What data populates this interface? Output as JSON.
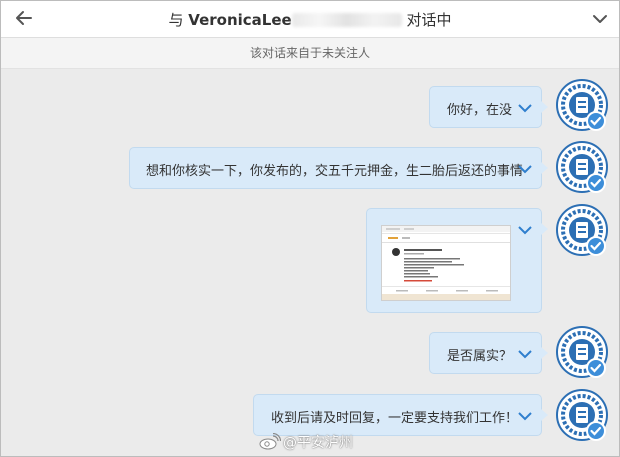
{
  "header": {
    "prefix": "与 ",
    "username_visible": "VeronicaLee",
    "suffix": " 对话中",
    "back_icon": "arrow-left-icon",
    "menu_icon": "chevron-down-icon"
  },
  "notice": "该对话来自于未关注人",
  "messages": [
    {
      "text": "你好，在没"
    },
    {
      "text": "想和你核实一下，你发布的，交五千元押金，生二胎后返还的事情"
    },
    {
      "text": "",
      "image": "screenshot-of-weibo-post"
    },
    {
      "text": "是否属实？"
    },
    {
      "text": "收到后请及时回复，一定要支持我们工作！"
    }
  ],
  "avatar": {
    "label": "police-emblem-avatar",
    "badge": "verified-badge"
  },
  "watermark": "@平安泸州",
  "colors": {
    "bubble": "#d9eaf9",
    "accent": "#2f7fce",
    "background": "#ebebeb"
  }
}
